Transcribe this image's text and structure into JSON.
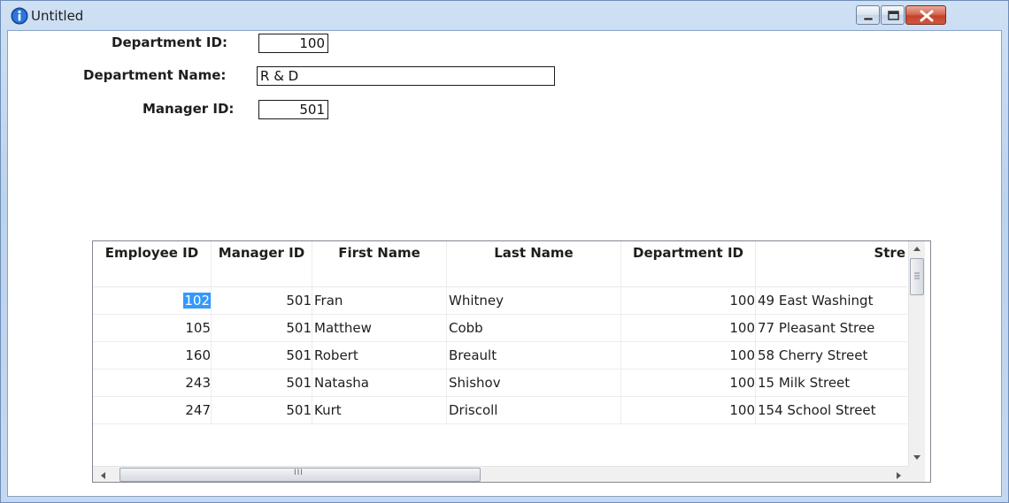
{
  "window": {
    "title": "Untitled",
    "icon": "info-icon",
    "controls": [
      "minimize-icon",
      "maximize-icon",
      "close-icon"
    ]
  },
  "form": {
    "department_id": {
      "label": "Department ID:",
      "value": "100"
    },
    "department_name": {
      "label": "Department Name:",
      "value": "R & D"
    },
    "manager_id": {
      "label": "Manager ID:",
      "value": "501"
    }
  },
  "grid": {
    "columns": [
      "Employee ID",
      "Manager ID",
      "First Name",
      "Last Name",
      "Department ID",
      "Stre"
    ],
    "rows": [
      {
        "employee_id": "102",
        "manager_id": "501",
        "first_name": "Fran",
        "last_name": "Whitney",
        "department_id": "100",
        "street": "49 East Washingt"
      },
      {
        "employee_id": "105",
        "manager_id": "501",
        "first_name": "Matthew",
        "last_name": "Cobb",
        "department_id": "100",
        "street": "77 Pleasant Stree"
      },
      {
        "employee_id": "160",
        "manager_id": "501",
        "first_name": "Robert",
        "last_name": "Breault",
        "department_id": "100",
        "street": "58 Cherry Street"
      },
      {
        "employee_id": "243",
        "manager_id": "501",
        "first_name": "Natasha",
        "last_name": "Shishov",
        "department_id": "100",
        "street": "15 Milk Street"
      },
      {
        "employee_id": "247",
        "manager_id": "501",
        "first_name": "Kurt",
        "last_name": "Driscoll",
        "department_id": "100",
        "street": "154 School Street"
      }
    ],
    "selected_cell": "102",
    "hscroll_grip": "III"
  },
  "colors": {
    "selection": "#3399ff",
    "close_button": "#c2432c",
    "window_frame": "#bcd3ee"
  }
}
